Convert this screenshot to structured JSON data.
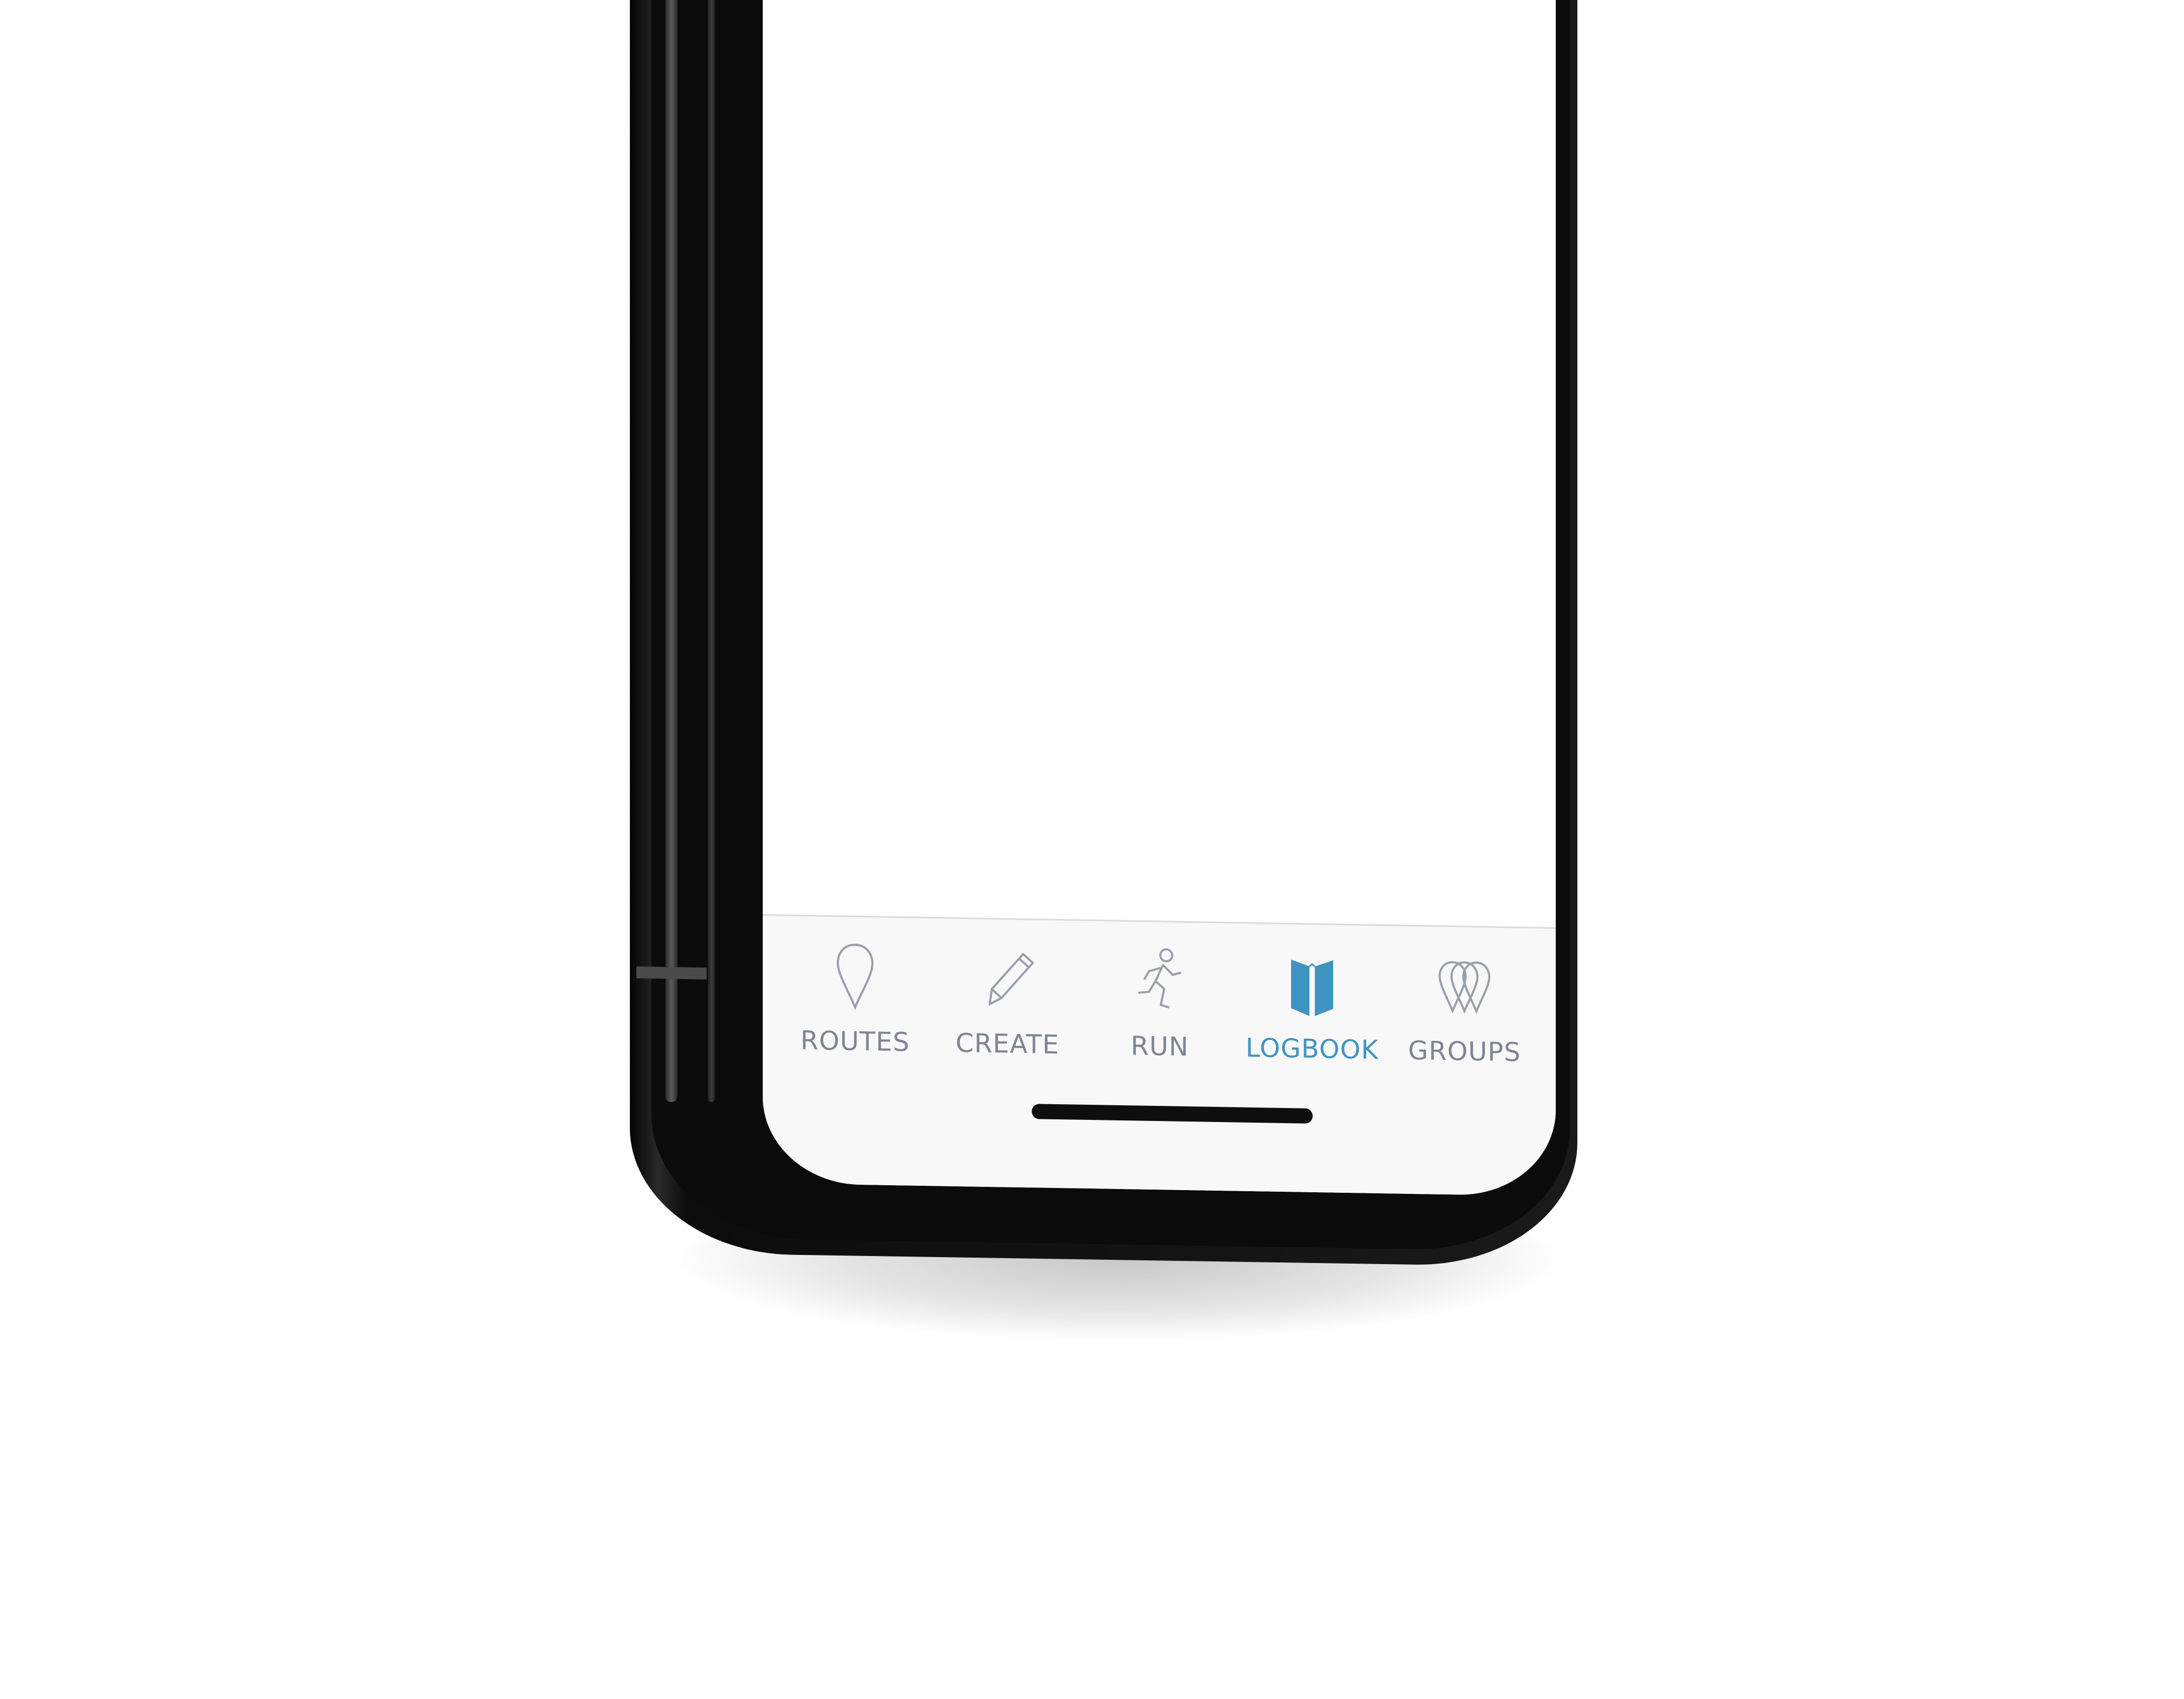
{
  "tabbar": {
    "accent_color": "#3f95c1",
    "inactive_color": "#7e8593",
    "items": [
      {
        "label": "ROUTES",
        "icon": "map-pin-icon",
        "active": false
      },
      {
        "label": "CREATE",
        "icon": "pencil-icon",
        "active": false
      },
      {
        "label": "RUN",
        "icon": "runner-icon",
        "active": false
      },
      {
        "label": "LOGBOOK",
        "icon": "book-icon",
        "active": true
      },
      {
        "label": "GROUPS",
        "icon": "group-pins-icon",
        "active": false
      }
    ]
  }
}
